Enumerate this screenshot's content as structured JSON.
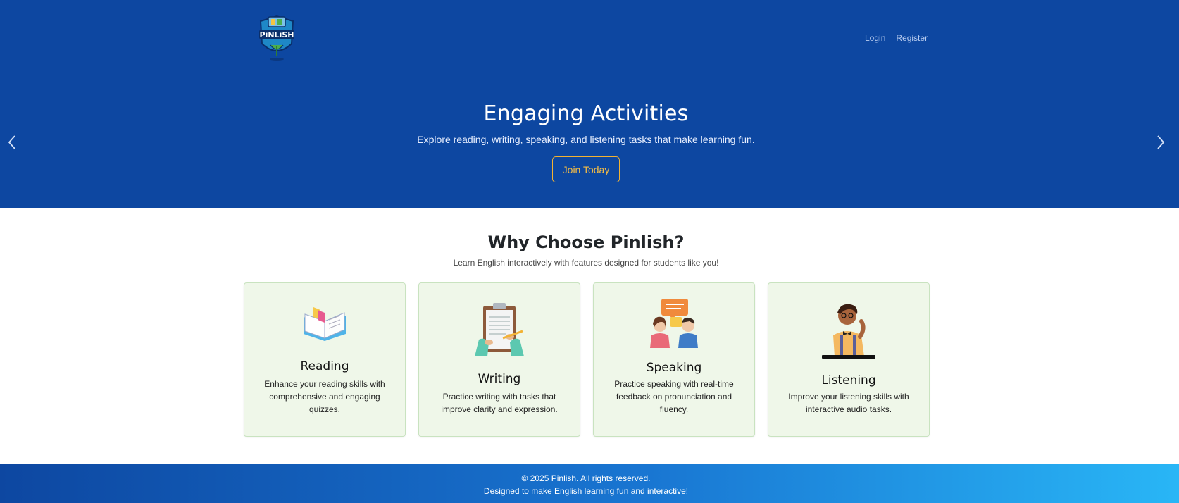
{
  "header": {
    "logo_text": "PiNLiSH",
    "nav": {
      "login": "Login",
      "register": "Register"
    }
  },
  "hero": {
    "title": "Engaging Activities",
    "subtitle": "Explore reading, writing, speaking, and listening tasks that make learning fun.",
    "cta": "Join Today",
    "prev_icon": "chevron-left-icon",
    "next_icon": "chevron-right-icon"
  },
  "features": {
    "title": "Why Choose Pinlish?",
    "subtitle": "Learn English interactively with features designed for students like you!",
    "cards": [
      {
        "title": "Reading",
        "desc": "Enhance your reading skills with comprehensive and engaging quizzes.",
        "icon": "open-book-icon"
      },
      {
        "title": "Writing",
        "desc": "Practice writing with tasks that improve clarity and expression.",
        "icon": "clipboard-writing-icon"
      },
      {
        "title": "Speaking",
        "desc": "Practice speaking with real-time feedback on pronunciation and fluency.",
        "icon": "conversation-icon"
      },
      {
        "title": "Listening",
        "desc": "Improve your listening skills with interactive audio tasks.",
        "icon": "listener-icon"
      }
    ]
  },
  "footer": {
    "copyright": "© 2025 Pinlish. All rights reserved.",
    "tagline": "Designed to make English learning fun and interactive!"
  },
  "colors": {
    "hero_bg": "#0d47a1",
    "cta_border": "#f2b233",
    "card_bg": "#eff7e9",
    "card_border": "#c9e3c0"
  }
}
